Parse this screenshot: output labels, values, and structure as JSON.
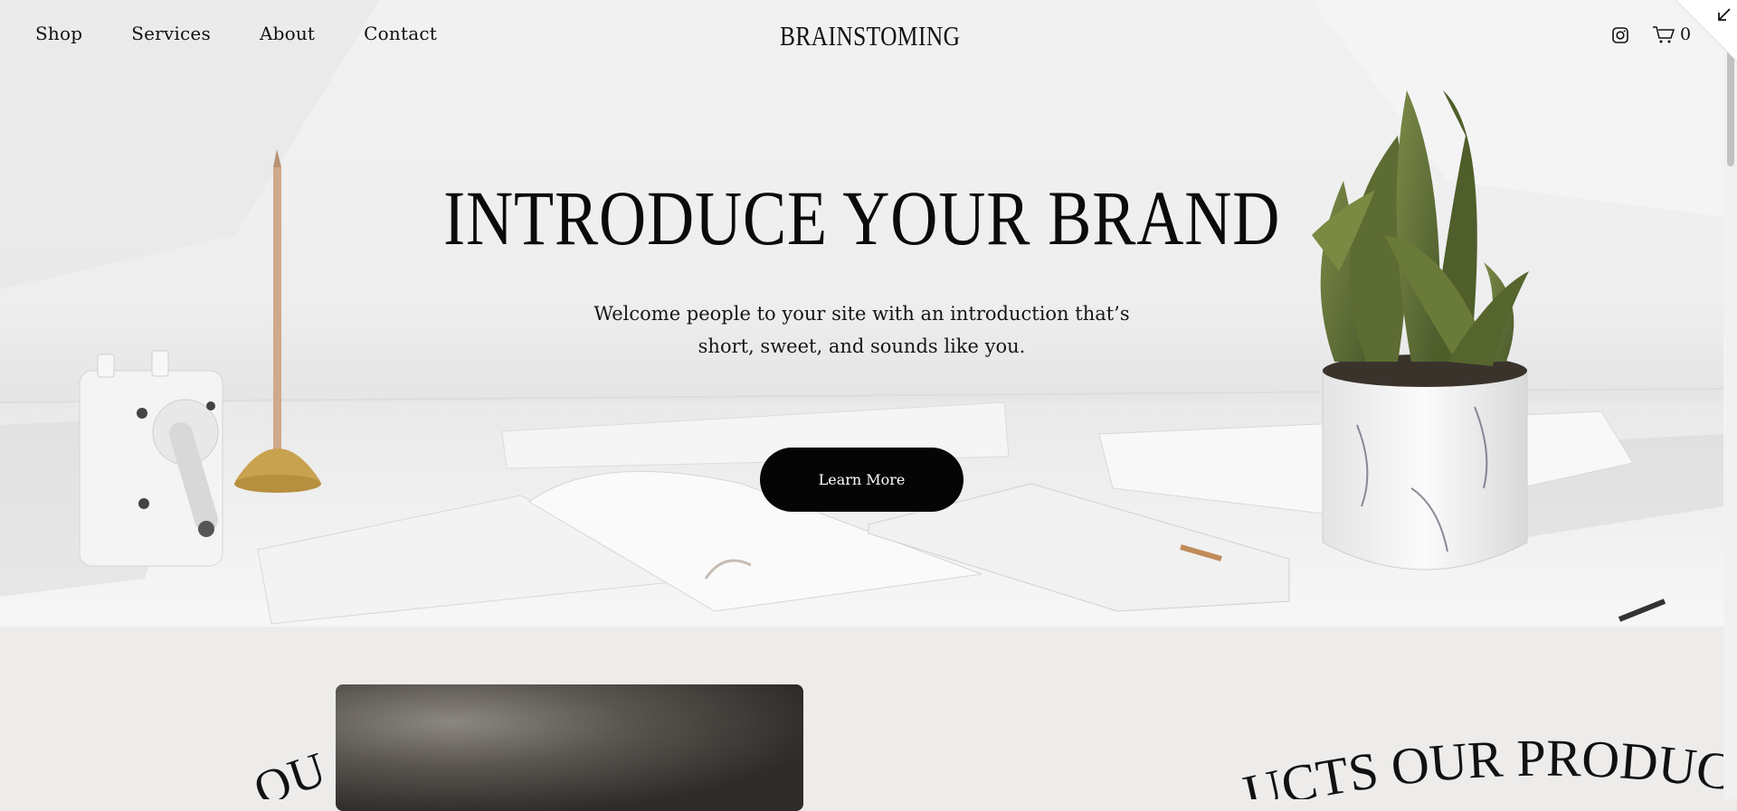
{
  "nav": {
    "links": [
      "Shop",
      "Services",
      "About",
      "Contact"
    ],
    "brand": "BRAINSTOMING",
    "cart_count": "0"
  },
  "hero": {
    "headline": "INTRODUCE YOUR BRAND",
    "subtext_line1": "Welcome people to your site with an introduction that’s",
    "subtext_line2": "short, sweet, and sounds like you.",
    "cta_label": "Learn More"
  },
  "lower": {
    "left_curved_fragment": "OU",
    "right_curved_text": "UCTS  OUR PRODUCTS"
  },
  "icons": {
    "instagram": "instagram-icon",
    "cart": "cart-icon",
    "corner": "collapse-arrow-icon"
  },
  "colors": {
    "page_bg": "#edeceb",
    "button_bg": "#050505",
    "text": "#111111"
  }
}
